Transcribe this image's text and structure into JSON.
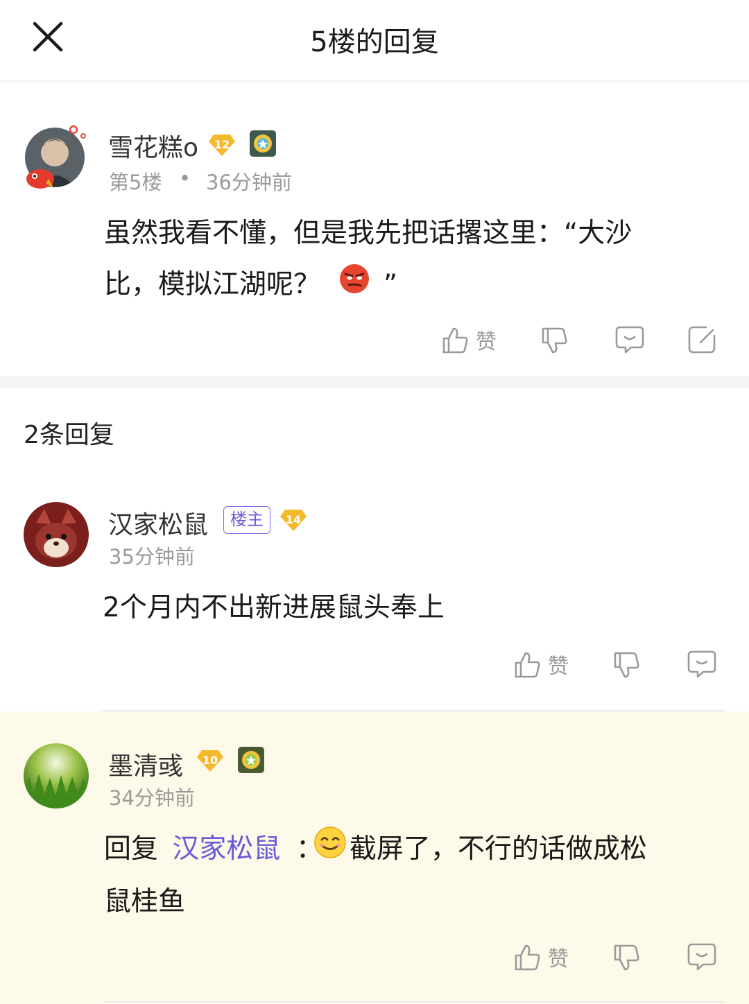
{
  "header": {
    "title": "5楼的回复",
    "close_icon": "close-icon"
  },
  "main_post": {
    "author": "雪花糕o",
    "level": "12",
    "floor": "第5楼",
    "separator": "•",
    "time": "36分钟前",
    "content_line1": "虽然我看不懂，但是我先把话撂这里：“大沙",
    "content_line2_prefix": "比，模拟江湖呢？",
    "content_line2_suffix": "”",
    "actions": {
      "like_label": "赞"
    }
  },
  "reply_section": {
    "count_label": "2条回复"
  },
  "replies": [
    {
      "author": "汉家松鼠",
      "owner_tag": "楼主",
      "level": "14",
      "time": "35分钟前",
      "content": "2个月内不出新进展鼠头奉上",
      "like_label": "赞"
    },
    {
      "author": "墨清彧",
      "level": "10",
      "time": "34分钟前",
      "reply_prefix": "回复",
      "reply_to": "汉家松鼠",
      "colon": "：",
      "content_line1": "截屏了，不行的话做成松",
      "content_line2": "鼠桂鱼",
      "like_label": "赞"
    }
  ],
  "colors": {
    "accent": "#6a5ad8",
    "badge_orange": "#f5b92c",
    "highlight_bg": "#fdfae9",
    "muted_text": "#9a9a9a"
  }
}
